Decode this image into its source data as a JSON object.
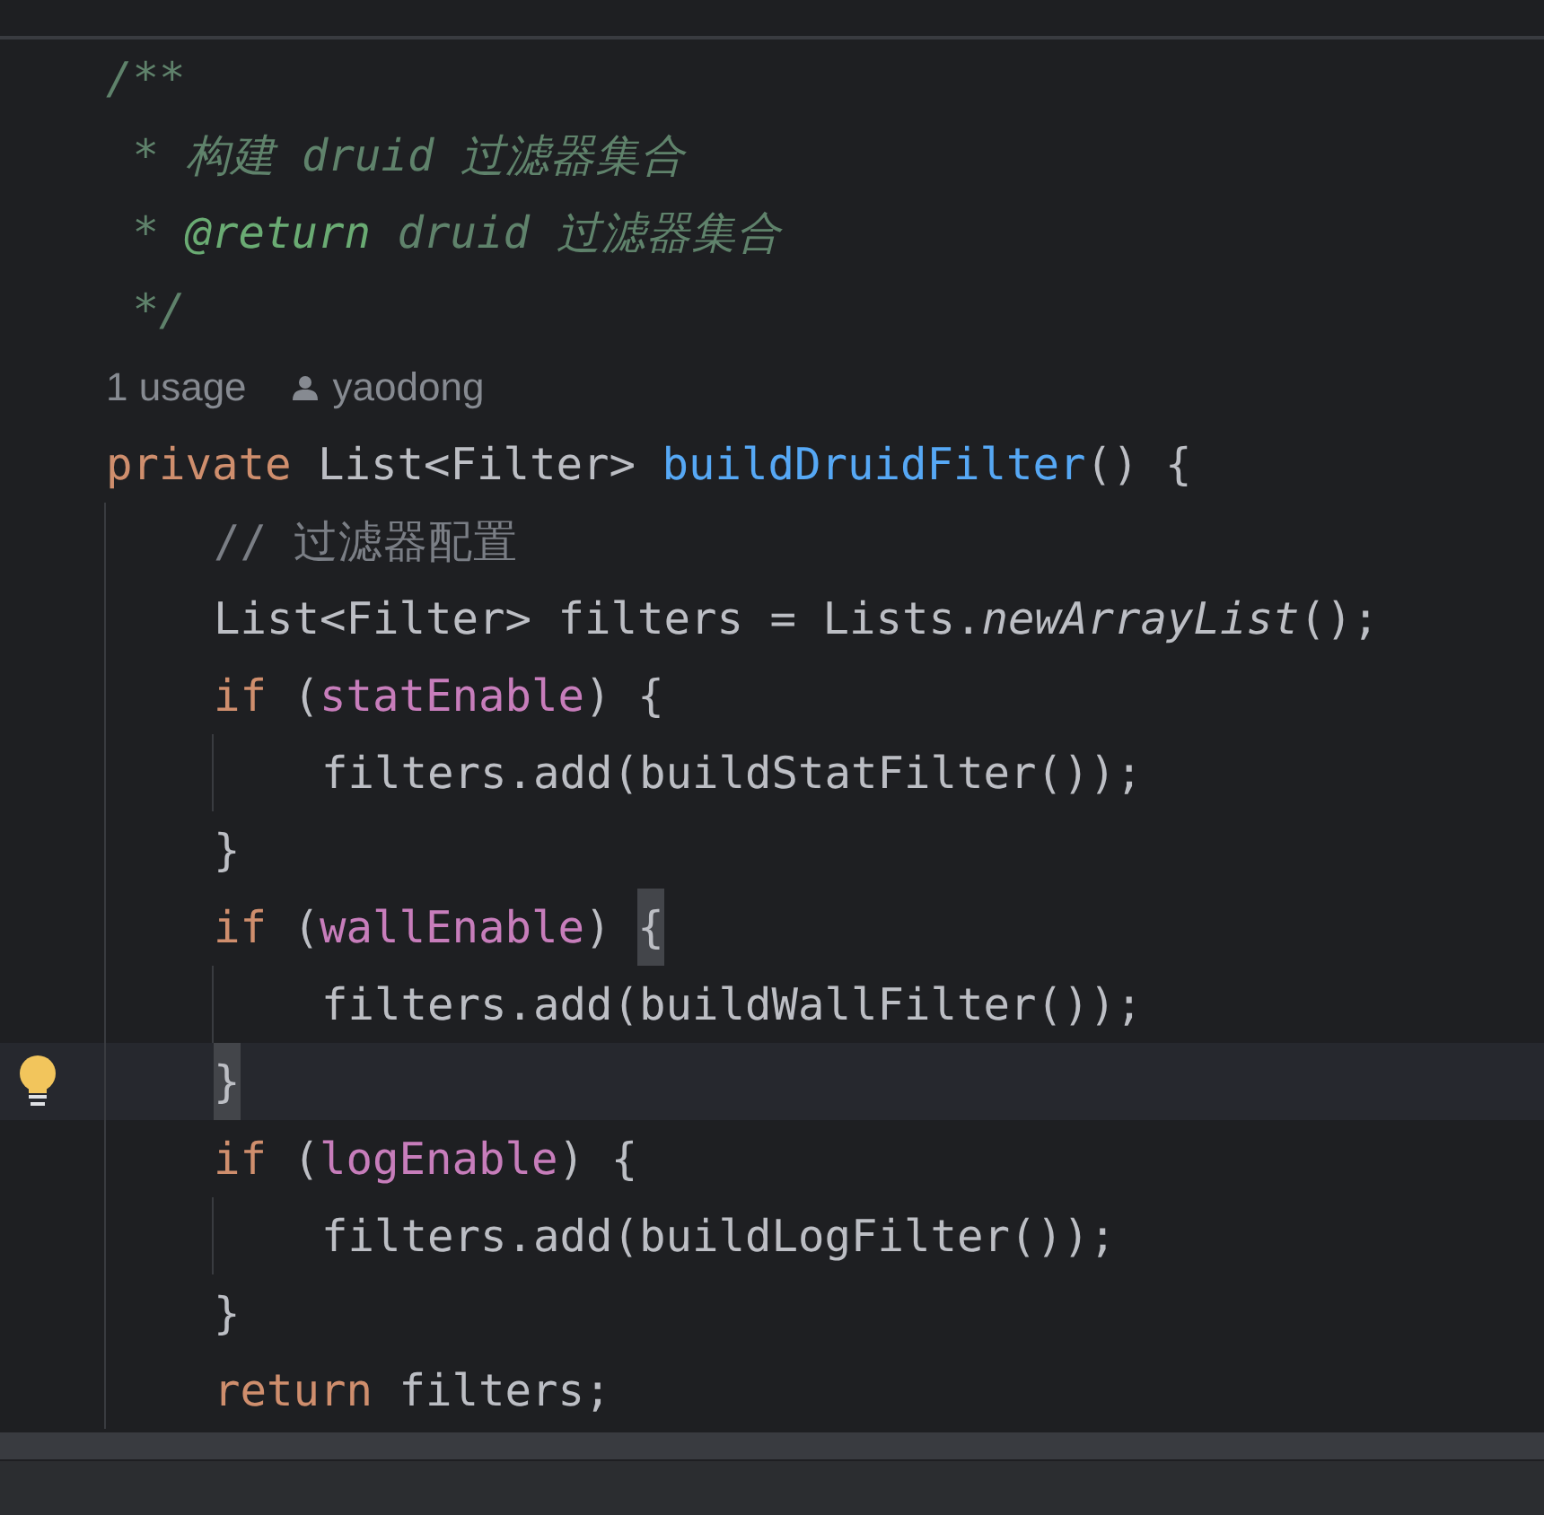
{
  "editor": {
    "lines": [
      {
        "kind": "code",
        "current": false,
        "tokens": [
          {
            "text": "/**",
            "kind": "doc"
          }
        ]
      },
      {
        "kind": "code",
        "current": false,
        "tokens": [
          {
            "text": " * 构建 druid 过滤器集合",
            "kind": "doc"
          }
        ]
      },
      {
        "kind": "code",
        "current": false,
        "tokens": [
          {
            "text": " * ",
            "kind": "doc"
          },
          {
            "text": "@return",
            "kind": "doc-tag"
          },
          {
            "text": " druid 过滤器集合",
            "kind": "doc"
          }
        ]
      },
      {
        "kind": "code",
        "current": false,
        "tokens": [
          {
            "text": " */",
            "kind": "doc"
          }
        ]
      },
      {
        "kind": "hint",
        "current": false,
        "usage": "1 usage",
        "author": "yaodong"
      },
      {
        "kind": "code",
        "current": false,
        "tokens": [
          {
            "text": "private ",
            "kind": "keyword"
          },
          {
            "text": "List<Filter> ",
            "kind": "plain"
          },
          {
            "text": "buildDruidFilter",
            "kind": "method"
          },
          {
            "text": "() {",
            "kind": "plain"
          }
        ]
      },
      {
        "kind": "code",
        "current": false,
        "tokens": [
          {
            "text": "    // 过滤器配置",
            "kind": "comment"
          }
        ]
      },
      {
        "kind": "code",
        "current": false,
        "tokens": [
          {
            "text": "    List<Filter> filters = Lists.",
            "kind": "plain"
          },
          {
            "text": "newArrayList",
            "kind": "static"
          },
          {
            "text": "();",
            "kind": "plain"
          }
        ]
      },
      {
        "kind": "code",
        "current": false,
        "tokens": [
          {
            "text": "    if ",
            "kind": "keyword"
          },
          {
            "text": "(",
            "kind": "plain"
          },
          {
            "text": "statEnable",
            "kind": "field"
          },
          {
            "text": ") {",
            "kind": "plain"
          }
        ]
      },
      {
        "kind": "code",
        "current": false,
        "tokens": [
          {
            "text": "        filters.add(buildStatFilter());",
            "kind": "plain"
          }
        ]
      },
      {
        "kind": "code",
        "current": false,
        "tokens": [
          {
            "text": "    }",
            "kind": "plain"
          }
        ]
      },
      {
        "kind": "code",
        "current": false,
        "tokens": [
          {
            "text": "    if ",
            "kind": "keyword"
          },
          {
            "text": "(",
            "kind": "plain"
          },
          {
            "text": "wallEnable",
            "kind": "field"
          },
          {
            "text": ") ",
            "kind": "plain"
          },
          {
            "text": "{",
            "kind": "brace-match"
          }
        ]
      },
      {
        "kind": "code",
        "current": false,
        "tokens": [
          {
            "text": "        filters.add(buildWallFilter());",
            "kind": "plain"
          }
        ]
      },
      {
        "kind": "code",
        "current": true,
        "tokens": [
          {
            "text": "    }",
            "kind": "brace-match"
          }
        ]
      },
      {
        "kind": "code",
        "current": false,
        "tokens": [
          {
            "text": "    if ",
            "kind": "keyword"
          },
          {
            "text": "(",
            "kind": "plain"
          },
          {
            "text": "logEnable",
            "kind": "field"
          },
          {
            "text": ") {",
            "kind": "plain"
          }
        ]
      },
      {
        "kind": "code",
        "current": false,
        "tokens": [
          {
            "text": "        filters.add(buildLogFilter());",
            "kind": "plain"
          }
        ]
      },
      {
        "kind": "code",
        "current": false,
        "tokens": [
          {
            "text": "    }",
            "kind": "plain"
          }
        ]
      },
      {
        "kind": "code",
        "current": false,
        "tokens": [
          {
            "text": "    return ",
            "kind": "keyword"
          },
          {
            "text": "filters;",
            "kind": "plain"
          }
        ]
      }
    ]
  }
}
